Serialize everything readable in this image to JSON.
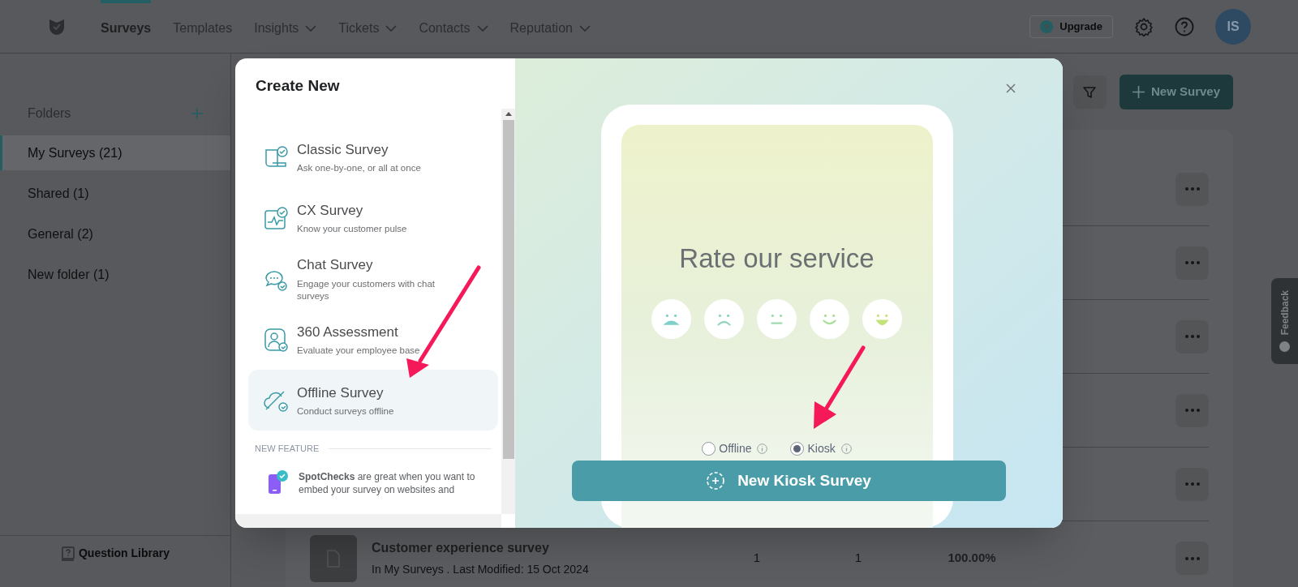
{
  "nav": {
    "items": [
      {
        "label": "Surveys",
        "selected": true,
        "dropdown": false
      },
      {
        "label": "Templates",
        "selected": false,
        "dropdown": false
      },
      {
        "label": "Insights",
        "selected": false,
        "dropdown": true
      },
      {
        "label": "Tickets",
        "selected": false,
        "dropdown": true
      },
      {
        "label": "Contacts",
        "selected": false,
        "dropdown": true
      },
      {
        "label": "Reputation",
        "selected": false,
        "dropdown": true
      }
    ],
    "upgrade": "Upgrade",
    "avatar": "IS"
  },
  "sidebar": {
    "title": "Folders",
    "items": [
      {
        "label": "My Surveys (21)",
        "selected": true
      },
      {
        "label": "Shared (1)",
        "selected": false
      },
      {
        "label": "General (2)",
        "selected": false
      },
      {
        "label": "New folder (1)",
        "selected": false
      }
    ],
    "footer": "Question Library"
  },
  "toolbar": {
    "new_survey": "New Survey"
  },
  "survey_rows": [
    {},
    {},
    {},
    {},
    {},
    {
      "title": "Customer experience survey",
      "meta": "In My Surveys . Last Modified: 15 Oct 2024",
      "column_2": "1",
      "column_3": "1",
      "column_4": "100.00%"
    }
  ],
  "modal": {
    "title": "Create New",
    "options": [
      {
        "kind": "classic",
        "title": "Classic Survey",
        "subtitle": "Ask one-by-one, or all at once",
        "selected": false
      },
      {
        "kind": "cx",
        "title": "CX Survey",
        "subtitle": "Know your customer pulse",
        "selected": false
      },
      {
        "kind": "chat",
        "title": "Chat Survey",
        "subtitle": "Engage your customers with chat surveys",
        "selected": false
      },
      {
        "kind": "assessment",
        "title": "360 Assessment",
        "subtitle": "Evaluate your employee base",
        "selected": false
      },
      {
        "kind": "offline",
        "title": "Offline Survey",
        "subtitle": "Conduct surveys offline",
        "selected": true
      }
    ],
    "new_feature_label": "NEW FEATURE",
    "spotchecks_text": "**SpotChecks** are great when you want to embed your survey on websites and",
    "preview": {
      "question": "Rate our service",
      "modes": [
        {
          "label": "Offline",
          "selected": false
        },
        {
          "label": "Kiosk",
          "selected": true
        }
      ]
    },
    "action": "New Kiosk Survey"
  },
  "feedback": "Feedback"
}
